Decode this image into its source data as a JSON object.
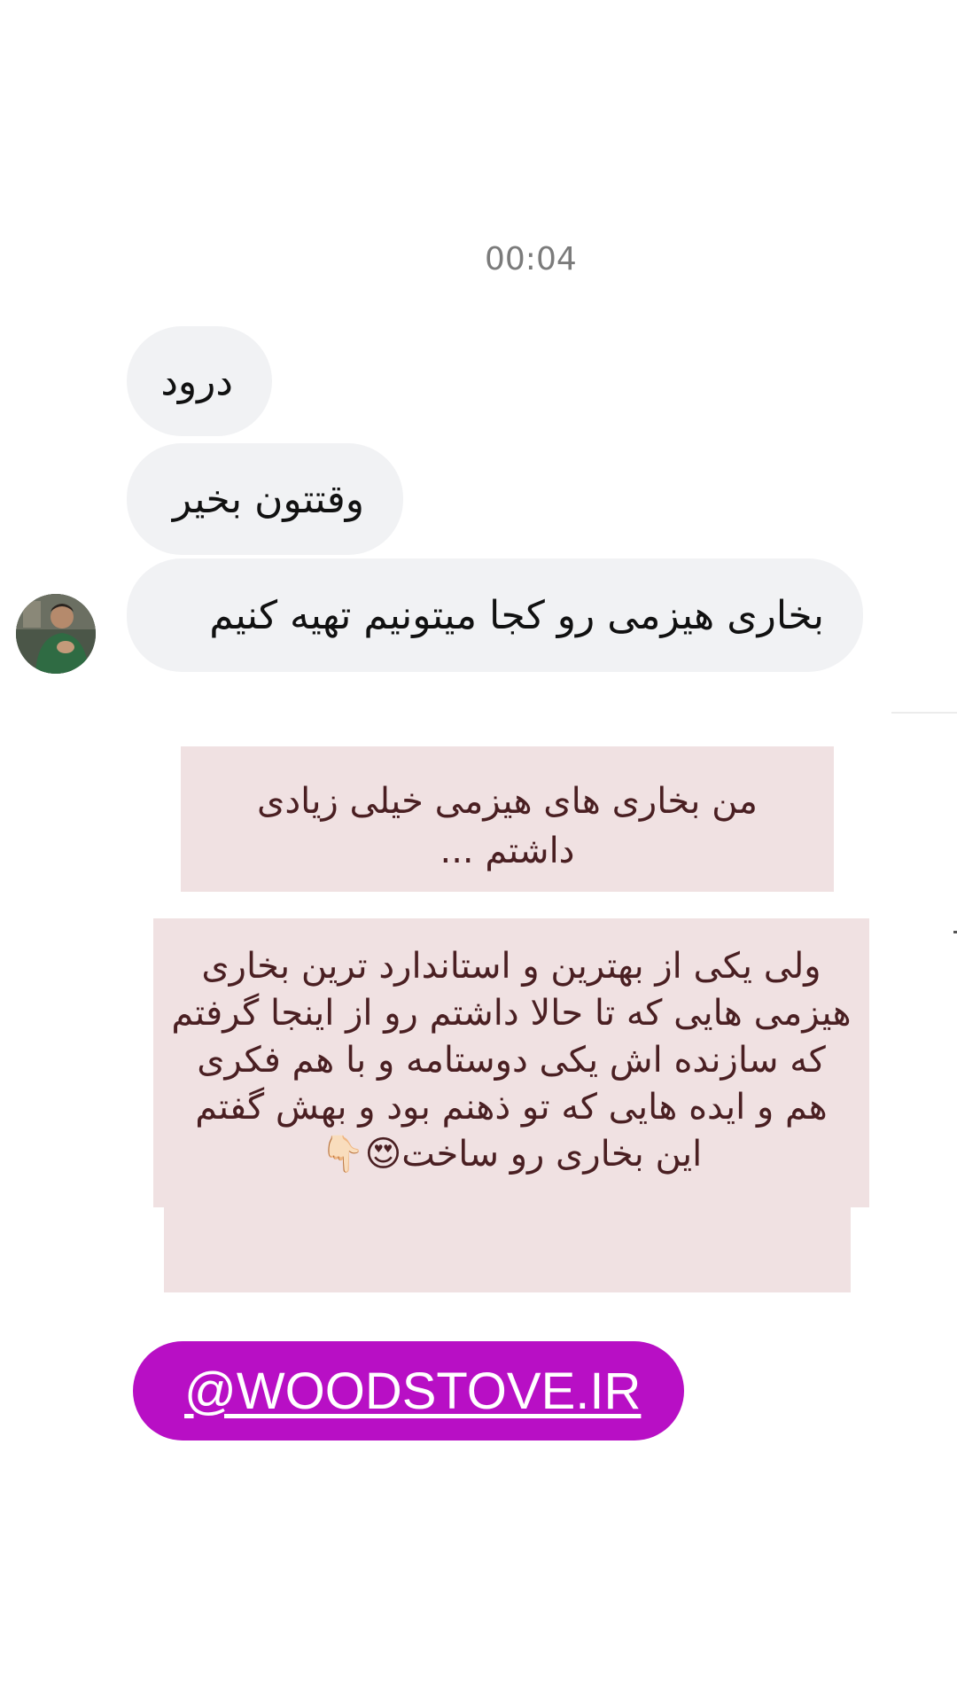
{
  "thread": {
    "timestamp": "00:04",
    "messages": [
      {
        "text": "درود"
      },
      {
        "text": "وقتتون بخیر"
      },
      {
        "text": "بخاری هیزمی رو کجا میتونیم تهیه کنیم"
      }
    ]
  },
  "overlay": {
    "card1": "من بخاری های هیزمی  خیلی زیادی داشتم ...",
    "card2": "ولی یکی از بهترین و استاندارد ترین بخاری هیزمی هایی که تا حالا داشتم رو از اینجا گرفتم که سازنده اش یکی دوستامه و با هم فکری هم و ایده هایی که تو ذهنم بود و بهش گفتم این بخاری رو ساخت😍👇🏻",
    "link_sticker": "@WOODSTOVE.IR"
  },
  "colors": {
    "bubble_bg": "#f1f2f4",
    "card_bg": "#f0e1e2",
    "card_text": "#4a1f22",
    "link_bg": "#b80fc5"
  },
  "icons": {
    "avatar": "sender-avatar"
  }
}
